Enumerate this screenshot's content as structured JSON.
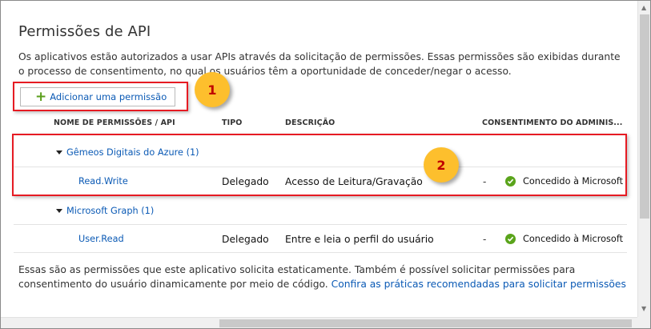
{
  "page": {
    "title": "Permissões de API",
    "description": "Os aplicativos estão autorizados a usar APIs através da solicitação de permissões. Essas permissões são exibidas durante o processo de consentimento, no qual os usuários têm a oportunidade de conceder/negar o acesso.",
    "add_permission_label": "Adicionar uma permissão",
    "plus_glyph": "+"
  },
  "callouts": {
    "one": "1",
    "two": "2"
  },
  "table": {
    "headers": {
      "name": "NOME DE PERMISSÕES / API",
      "type": "TIPO",
      "description": "DESCRIÇÃO",
      "consent": "CONSENTIMENTO DO ADMINIS..."
    },
    "groups": [
      {
        "name": "Gêmeos Digitais do Azure (1)",
        "permissions": [
          {
            "name": "Read.Write",
            "type": "Delegado",
            "description": "Acesso de Leitura/Gravação",
            "admin_consent": "-",
            "status": "Concedido à Microsoft"
          }
        ]
      },
      {
        "name": "Microsoft Graph (1)",
        "permissions": [
          {
            "name": "User.Read",
            "type": "Delegado",
            "description": "Entre e leia o perfil do usuário",
            "admin_consent": "-",
            "status": "Concedido à Microsoft"
          }
        ]
      }
    ]
  },
  "footer": {
    "text": "Essas são as permissões que este aplicativo solicita estaticamente. Também é possível solicitar permissões para consentimento do usuário dinamicamente por meio de código. ",
    "link": "Confira as práticas recomendadas para solicitar permissões"
  },
  "scrollbar": {
    "up_arrow": "▲",
    "down_arrow": "▼"
  },
  "colors": {
    "link": "#0b5ab5",
    "highlight": "#e61b23",
    "badge": "#fdbf2d",
    "success": "#5aa41b",
    "add_icon": "#5a9e1b"
  }
}
